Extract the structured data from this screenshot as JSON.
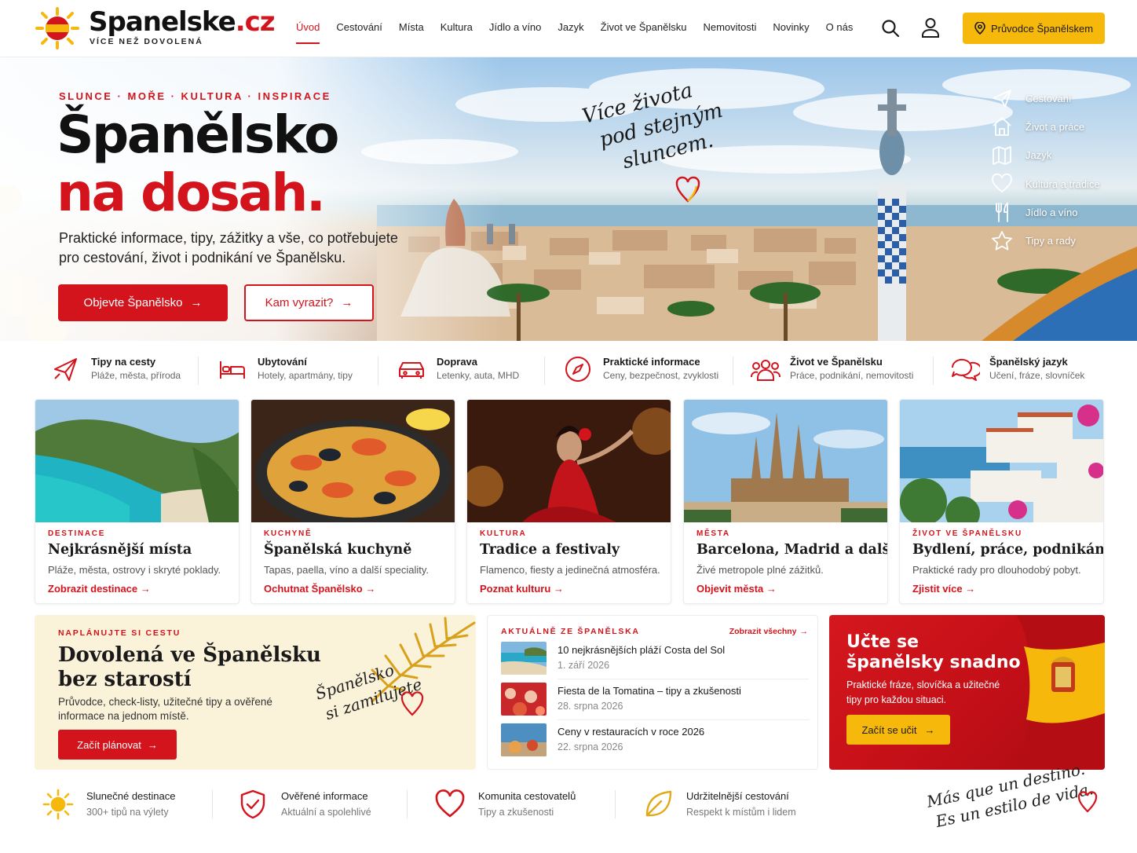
{
  "brand": {
    "name": "Spanelske",
    "tld": ".cz",
    "tagline": "VÍCE NEŽ DOVOLENÁ"
  },
  "nav": {
    "items": [
      "Úvod",
      "Cestování",
      "Místa",
      "Kultura",
      "Jídlo a víno",
      "Jazyk",
      "Život ve Španělsku",
      "Nemovitosti",
      "Novinky",
      "O nás"
    ],
    "active": "Úvod",
    "guide_label": "Průvodce Španělskem"
  },
  "hero": {
    "eyebrow": "SLUNCE · MOŘE · KULTURA · INSPIRACE",
    "title_line1": "Španělsko",
    "title_line2": "na dosah.",
    "subtitle": "Praktické informace, tipy, zážitky a vše, co potřebujete pro cestování, život i podnikání ve Španělsku.",
    "cta_primary": "Objevte Španělsko",
    "cta_secondary": "Kam vyrazit?",
    "script": [
      "Více života",
      "pod stejným",
      "sluncem."
    ],
    "quick_links": [
      {
        "label": "Cestování",
        "icon": "plane-icon"
      },
      {
        "label": "Život a práce",
        "icon": "home-icon"
      },
      {
        "label": "Jazyk",
        "icon": "map-icon"
      },
      {
        "label": "Kultura a tradice",
        "icon": "heart-icon"
      },
      {
        "label": "Jídlo a víno",
        "icon": "cutlery-icon"
      },
      {
        "label": "Tipy a rady",
        "icon": "star-icon"
      }
    ]
  },
  "categories": [
    {
      "title": "Tipy na cesty",
      "subtitle": "Pláže, města, příroda",
      "icon": "plane-icon"
    },
    {
      "title": "Ubytování",
      "subtitle": "Hotely, apartmány, tipy",
      "icon": "bed-icon"
    },
    {
      "title": "Doprava",
      "subtitle": "Letenky, auta, MHD",
      "icon": "car-icon"
    },
    {
      "title": "Praktické informace",
      "subtitle": "Ceny, bezpečnost, zvyklosti",
      "icon": "compass-icon"
    },
    {
      "title": "Život ve Španělsku",
      "subtitle": "Práce, podnikání, nemovitosti",
      "icon": "people-icon"
    },
    {
      "title": "Španělský jazyk",
      "subtitle": "Učení, fráze, slovníček",
      "icon": "chat-icon"
    }
  ],
  "cards": [
    {
      "tag": "DESTINACE",
      "title": "Nejkrásnější místa",
      "desc": "Pláže, města, ostrovy i skryté poklady.",
      "link": "Zobrazit destinace"
    },
    {
      "tag": "KUCHYNĚ",
      "title": "Španělská kuchyně",
      "desc": "Tapas, paella, víno a další speciality.",
      "link": "Ochutnat Španělsko"
    },
    {
      "tag": "KULTURA",
      "title": "Tradice a festivaly",
      "desc": "Flamenco, fiesty a jedinečná atmosféra.",
      "link": "Poznat kulturu"
    },
    {
      "tag": "MĚSTA",
      "title": "Barcelona, Madrid a další",
      "desc": "Živé metropole plné zážitků.",
      "link": "Objevit města"
    },
    {
      "tag": "ŽIVOT VE ŠPANĚLSKU",
      "title": "Bydlení, práce, podnikání",
      "desc": "Praktické rady pro dlouhodobý pobyt.",
      "link": "Zjistit více"
    }
  ],
  "plan": {
    "eyebrow": "NAPLÁNUJTE SI CESTU",
    "title": "Dovolená ve Španělsku bez starostí",
    "desc": "Průvodce, check-listy, užitečné tipy a ověřené informace na jednom místě.",
    "button": "Začít plánovat",
    "script": [
      "Španělsko",
      "si zamilujete"
    ]
  },
  "news": {
    "eyebrow": "AKTUÁLNĚ ZE ŠPANĚLSKA",
    "all_link": "Zobrazit všechny",
    "items": [
      {
        "title": "10 nejkrásnějších pláží Costa del Sol",
        "date": "1. září 2026"
      },
      {
        "title": "Fiesta de la Tomatina – tipy a zkušenosti",
        "date": "28. srpna 2026"
      },
      {
        "title": "Ceny v restauracích v roce 2026",
        "date": "22. srpna 2026"
      }
    ]
  },
  "learn": {
    "title_line1": "Učte se",
    "title_line2": "španělsky snadno",
    "desc": "Praktické fráze, slovíčka a užitečné tipy pro každou situaci.",
    "button": "Začít se učit"
  },
  "features": [
    {
      "title": "Slunečné destinace",
      "subtitle": "300+ tipů na výlety",
      "icon": "sun-icon"
    },
    {
      "title": "Ověřené informace",
      "subtitle": "Aktuální a spolehlivé",
      "icon": "shield-check-icon"
    },
    {
      "title": "Komunita cestovatelů",
      "subtitle": "Tipy a zkušenosti",
      "icon": "heart-icon"
    },
    {
      "title": "Udržitelnější cestování",
      "subtitle": "Respekt k místům i lidem",
      "icon": "leaf-icon"
    }
  ],
  "footer_script": [
    "Más que un destino.",
    "Es un estilo de vida."
  ],
  "colors": {
    "primary_red": "#d4141c",
    "accent_yellow": "#f6b80b",
    "plan_bg": "#fbf2da"
  }
}
